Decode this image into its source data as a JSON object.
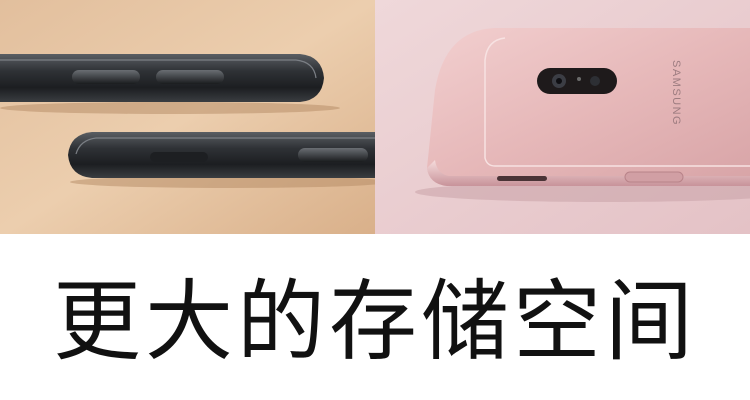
{
  "colors": {
    "beige_background": "#e6c39f",
    "pink_background": "#ecd0d3",
    "phone_black": "#2c2f33",
    "phone_pink": "#e3b7b8",
    "headline_text": "#111111"
  },
  "photo": {
    "brand_logo_text": "SAMSUNG"
  },
  "headline": {
    "text": "更大的存储空间"
  }
}
